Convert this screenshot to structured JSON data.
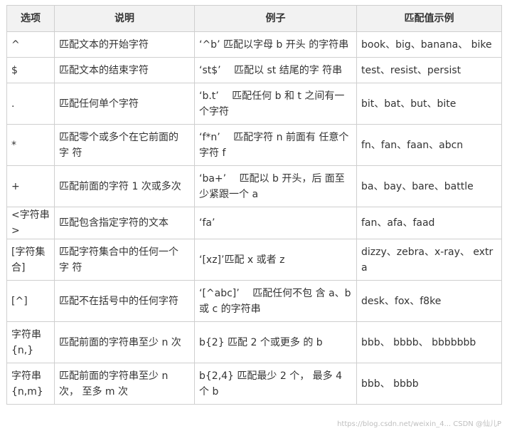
{
  "table": {
    "headers": [
      "选项",
      "说明",
      "例子",
      "匹配值示例"
    ],
    "rows": [
      [
        "^",
        "匹配文本的开始字符",
        "‘^b’ 匹配以字母 b 开头 的字符串",
        "book、big、banana、 bike"
      ],
      [
        "$",
        "匹配文本的结束字符",
        "‘st$’ 　匹配以 st 结尾的字 符串",
        "test、resist、persist"
      ],
      [
        ".",
        "匹配任何单个字符",
        "‘b.t’ 　匹配任何 b 和 t 之间有一个字符",
        "bit、bat、but、bite"
      ],
      [
        "*",
        "匹配零个或多个在它前面的 字 符",
        "‘f*n’ 　匹配字符 n 前面有 任意个字符 f",
        "fn、fan、faan、abcn"
      ],
      [
        "+",
        "匹配前面的字符 1 次或多次",
        "‘ba+’ 　匹配以 b 开头，后 面至少紧跟一个 a",
        "ba、bay、bare、battle"
      ],
      [
        "<字符串>",
        "匹配包含指定字符的文本",
        "‘fa’",
        "fan、afa、faad"
      ],
      [
        "[字符集合]",
        "匹配字符集合中的任何一个 字 符",
        "‘[xz]’匹配 x 或者 z",
        "dizzy、zebra、x-ray、 extra"
      ],
      [
        "[^]",
        "匹配不在括号中的任何字符",
        "‘[^abc]’ 　匹配任何不包 含 a、b 或 c 的字符串",
        "desk、fox、f8ke"
      ],
      [
        "字符串{n,}",
        "匹配前面的字符串至少 n 次",
        "b{2} 匹配 2 个或更多 的 b",
        "bbb、 bbbb、 bbbbbbb"
      ],
      [
        "字符串{n,m}",
        "匹配前面的字符串至少 n 次， 至多 m 次",
        "b{2,4} 匹配最少 2 个， 最多 4 个 b",
        "bbb、 bbbb"
      ]
    ]
  },
  "watermark": "https://blog.csdn.net/weixin_4...  CSDN @仙儿P"
}
